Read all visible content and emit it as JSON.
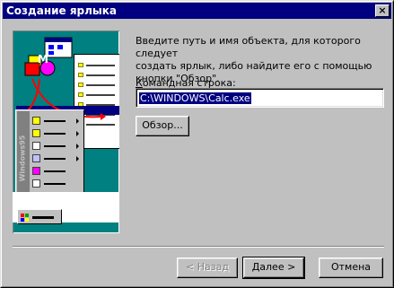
{
  "window": {
    "title": "Создание ярлыка",
    "close_glyph": "×"
  },
  "illustration": {
    "sidebar_text": "Windows95",
    "icon": "shortcut-illustration"
  },
  "main": {
    "instructions": "Введите путь и имя объекта, для которого следует\nсоздать ярлык, либо найдите его с помощью\nкнопки \"Обзор\".",
    "command_label_accel": "К",
    "command_label_rest": "омандная строка:",
    "command_value": "C:\\WINDOWS\\Calc.exe",
    "browse_label": "Обзор..."
  },
  "footer": {
    "back_label": "< Назад",
    "next_label": "Далее >",
    "cancel_label": "Отмена"
  },
  "colors": {
    "titlebar": "#000080",
    "face": "#c0c0c0",
    "teal": "#008080"
  }
}
